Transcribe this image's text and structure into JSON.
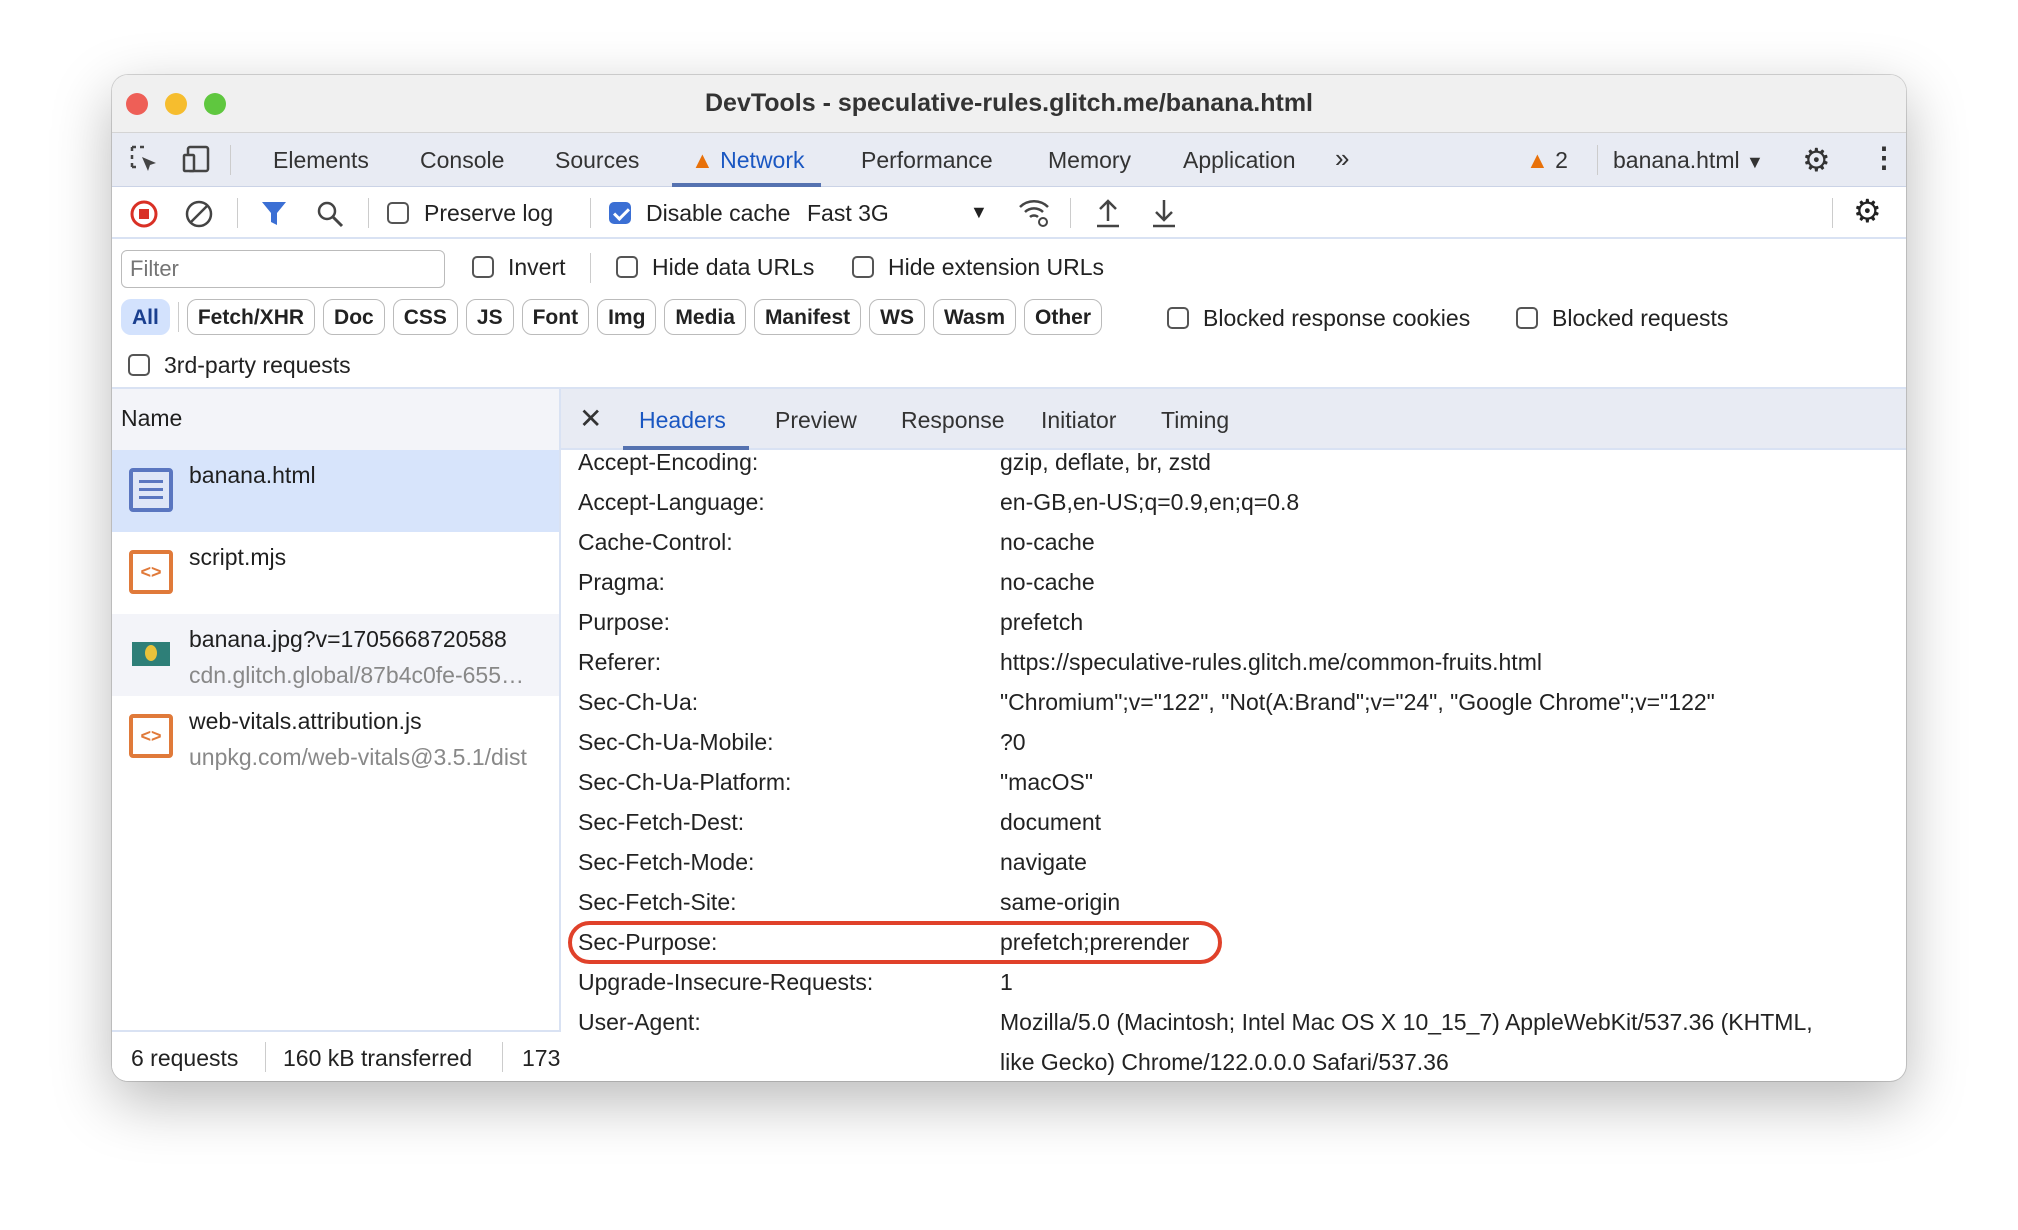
{
  "window": {
    "title": "DevTools - speculative-rules.glitch.me/banana.html"
  },
  "tabs": [
    "Elements",
    "Console",
    "Sources",
    "Network",
    "Performance",
    "Memory",
    "Application"
  ],
  "active_tab": "Network",
  "more_tabs": "»",
  "issues_count": "2",
  "context": "banana.html",
  "toolbar": {
    "preserve_log": "Preserve log",
    "preserve_log_checked": false,
    "disable_cache": "Disable cache",
    "disable_cache_checked": true,
    "throttle": "Fast 3G"
  },
  "filter": {
    "placeholder": "Filter",
    "invert": "Invert",
    "hide_data_urls": "Hide data URLs",
    "hide_extension_urls": "Hide extension URLs"
  },
  "types": [
    "All",
    "Fetch/XHR",
    "Doc",
    "CSS",
    "JS",
    "Font",
    "Img",
    "Media",
    "Manifest",
    "WS",
    "Wasm",
    "Other"
  ],
  "blocked_cookies": "Blocked response cookies",
  "blocked_requests": "Blocked requests",
  "third_party": "3rd-party requests",
  "list": {
    "header": "Name",
    "requests": [
      {
        "name": "banana.html",
        "url": "",
        "icon": "document-icon"
      },
      {
        "name": "script.mjs",
        "url": "",
        "icon": "script-icon"
      },
      {
        "name": "banana.jpg?v=1705668720588",
        "url": "cdn.glitch.global/87b4c0fe-655…",
        "icon": "image-icon"
      },
      {
        "name": "web-vitals.attribution.js",
        "url": "unpkg.com/web-vitals@3.5.1/dist",
        "icon": "script-icon"
      }
    ]
  },
  "footer": {
    "requests": "6 requests",
    "transferred": "160 kB transferred",
    "resources": "173"
  },
  "detail_tabs": [
    "Headers",
    "Preview",
    "Response",
    "Initiator",
    "Timing"
  ],
  "headers": [
    {
      "k": "Accept-Encoding:",
      "v": "gzip, deflate, br, zstd"
    },
    {
      "k": "Accept-Language:",
      "v": "en-GB,en-US;q=0.9,en;q=0.8"
    },
    {
      "k": "Cache-Control:",
      "v": "no-cache"
    },
    {
      "k": "Pragma:",
      "v": "no-cache"
    },
    {
      "k": "Purpose:",
      "v": "prefetch"
    },
    {
      "k": "Referer:",
      "v": "https://speculative-rules.glitch.me/common-fruits.html"
    },
    {
      "k": "Sec-Ch-Ua:",
      "v": "\"Chromium\";v=\"122\", \"Not(A:Brand\";v=\"24\", \"Google Chrome\";v=\"122\""
    },
    {
      "k": "Sec-Ch-Ua-Mobile:",
      "v": "?0"
    },
    {
      "k": "Sec-Ch-Ua-Platform:",
      "v": "\"macOS\""
    },
    {
      "k": "Sec-Fetch-Dest:",
      "v": "document"
    },
    {
      "k": "Sec-Fetch-Mode:",
      "v": "navigate"
    },
    {
      "k": "Sec-Fetch-Site:",
      "v": "same-origin"
    },
    {
      "k": "Sec-Purpose:",
      "v": "prefetch;prerender"
    },
    {
      "k": "Upgrade-Insecure-Requests:",
      "v": "1"
    },
    {
      "k": "User-Agent:",
      "v": "Mozilla/5.0 (Macintosh; Intel Mac OS X 10_15_7) AppleWebKit/537.36 (KHTML,"
    },
    {
      "k": "",
      "v": "like Gecko) Chrome/122.0.0.0 Safari/537.36"
    }
  ],
  "highlight_color": "#e0412a",
  "accent": "#1a57c2"
}
